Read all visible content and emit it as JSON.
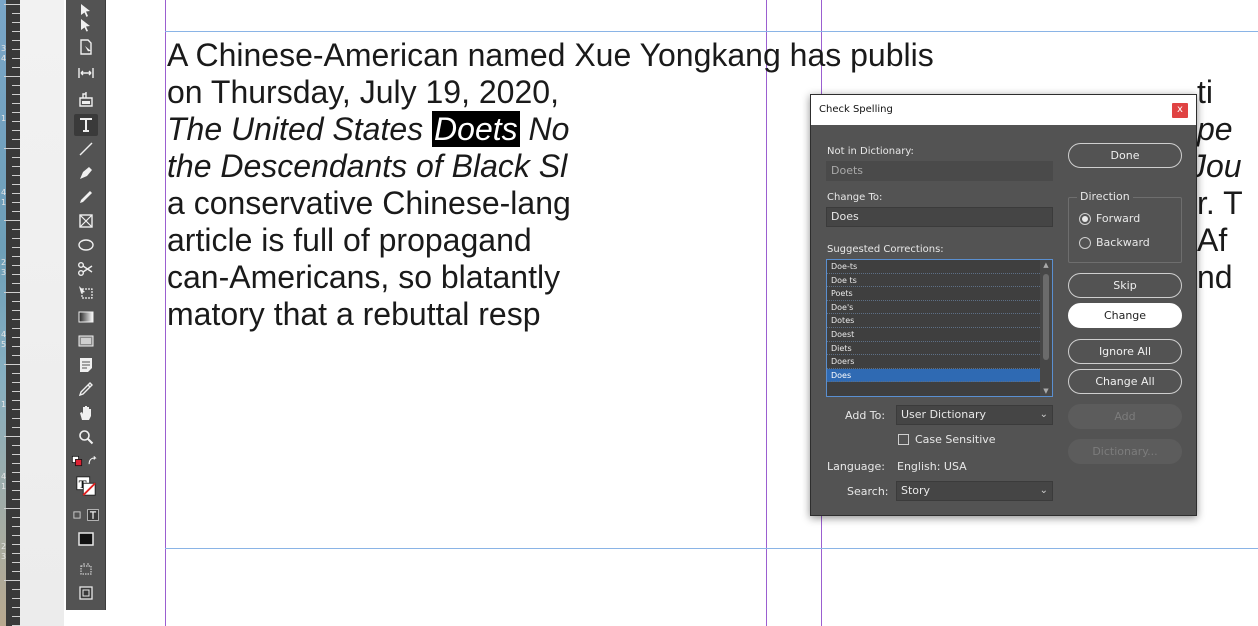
{
  "ruler": {
    "numbers": [
      "3",
      "4",
      "1",
      "4",
      "1",
      "2",
      "3",
      "4",
      "5",
      "1",
      "4",
      "1",
      "2",
      "3"
    ]
  },
  "story": {
    "lines": [
      {
        "text": "A Chinese-American named Xue  Yongkang  has  publis",
        "style": "normal"
      },
      {
        "text": "on  Thursday,  July  19,  2020,",
        "style": "normal"
      },
      {
        "pre": "The  United  States  ",
        "hl": "Doets",
        "post": "  No",
        "style": "italic"
      },
      {
        "text": "the  Descendants  of  Black  Sl",
        "style": "italic"
      },
      {
        "text": "a  conservative  Chinese-lang",
        "style": "normal"
      },
      {
        "text": "article  is  full  of  propagand",
        "style": "normal"
      },
      {
        "text": "can-Americans,  so  blatantly",
        "style": "normal"
      },
      {
        "text": "matory  that  a  rebuttal  resp",
        "style": "normal"
      }
    ],
    "right_fragments": [
      {
        "text": "ti",
        "line": 1
      },
      {
        "text": "pe",
        "line": 2,
        "style": "italic"
      },
      {
        "text": "Jou",
        "line": 3,
        "style": "italic"
      },
      {
        "text": "r.  T",
        "line": 4
      },
      {
        "text": "Af",
        "line": 5
      },
      {
        "text": "nd",
        "line": 6
      }
    ]
  },
  "dialog": {
    "title": "Check Spelling",
    "close_label": "x",
    "not_in_dictionary_label": "Not in Dictionary:",
    "not_in_dictionary_value": "Doets",
    "change_to_label": "Change To:",
    "change_to_value": "Does",
    "suggested_label": "Suggested Corrections:",
    "suggestions": [
      "Doe-ts",
      "Doe ts",
      "Poets",
      "Doe's",
      "Dotes",
      "Doest",
      "Diets",
      "Doers",
      "Does"
    ],
    "selected_suggestion": "Does",
    "buttons": {
      "done": "Done",
      "skip": "Skip",
      "change": "Change",
      "ignore_all": "Ignore All",
      "change_all": "Change All",
      "add": "Add",
      "dictionary": "Dictionary..."
    },
    "direction_label": "Direction",
    "direction_forward": "Forward",
    "direction_backward": "Backward",
    "direction_selected": "Forward",
    "add_to_label": "Add To:",
    "add_to_value": "User Dictionary",
    "case_sensitive_label": "Case Sensitive",
    "case_sensitive_checked": false,
    "language_label": "Language:",
    "language_value": "English: USA",
    "search_label": "Search:",
    "search_value": "Story"
  },
  "colors": {
    "guide_vertical": "#9b5fd0",
    "guide_horizontal": "#8ab4e6",
    "dialog_bg": "#535353",
    "selection": "#2f6ab3",
    "close_button": "#e04343"
  },
  "tools": [
    "selection-tool-icon",
    "direct-selection-tool-icon",
    "page-tool-icon",
    "gap-tool-icon",
    "content-collector-icon",
    "type-tool-icon",
    "line-tool-icon",
    "pen-tool-icon",
    "pencil-tool-icon",
    "rectangle-frame-tool-icon",
    "ellipse-tool-icon",
    "scissors-tool-icon",
    "free-transform-tool-icon",
    "gradient-swatch-tool-icon",
    "gradient-feather-tool-icon",
    "note-tool-icon",
    "eyedropper-tool-icon",
    "hand-tool-icon",
    "zoom-tool-icon",
    "default-fill-stroke-icon",
    "swap-fill-stroke-icon",
    "formatting-affects-text-icon",
    "fill-stroke-swatch-icon",
    "apply-container-text-icon",
    "normal-view-icon",
    "screen-mode-icon",
    "preview-mode-icon"
  ]
}
